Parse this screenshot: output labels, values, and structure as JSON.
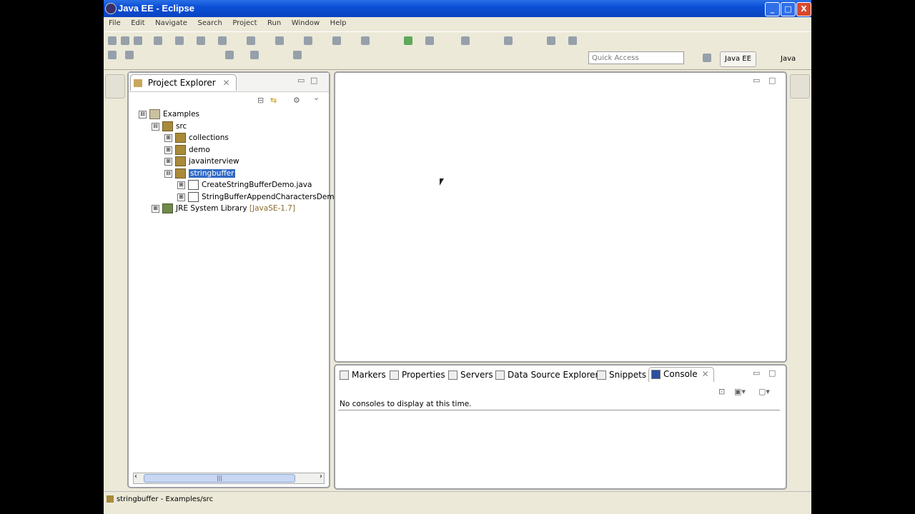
{
  "window": {
    "title": "Java EE - Eclipse",
    "minimize": "_",
    "maximize": "□",
    "close": "X"
  },
  "menu": [
    "File",
    "Edit",
    "Navigate",
    "Search",
    "Project",
    "Run",
    "Window",
    "Help"
  ],
  "toolbar": {
    "quick_access_placeholder": "Quick Access",
    "perspectives": [
      "Java EE",
      "Java"
    ]
  },
  "project_explorer": {
    "tab_label": "Project Explorer",
    "tree": [
      {
        "label": "Examples",
        "type": "project",
        "expander": "⊟"
      },
      {
        "label": "src",
        "type": "folder",
        "expander": "⊟"
      },
      {
        "label": "collections",
        "type": "package",
        "expander": "⊞"
      },
      {
        "label": "demo",
        "type": "package",
        "expander": "⊞"
      },
      {
        "label": "javainterview",
        "type": "package",
        "expander": "⊞"
      },
      {
        "label": "stringbuffer",
        "type": "package",
        "expander": "⊟",
        "selected": true
      },
      {
        "label": "CreateStringBufferDemo.java",
        "type": "file",
        "expander": "⊞"
      },
      {
        "label": "StringBufferAppendCharactersDemo",
        "type": "file",
        "expander": "⊞"
      },
      {
        "label": "JRE System Library",
        "type": "library",
        "expander": "⊞",
        "version": "[JavaSE-1.7]"
      }
    ],
    "scroll_thumb": "|||"
  },
  "bottom_panel": {
    "tabs": [
      "Markers",
      "Properties",
      "Servers",
      "Data Source Explorer",
      "Snippets",
      "Console"
    ],
    "active_tab": "Console",
    "message": "No consoles to display at this time."
  },
  "status_bar": {
    "text": "stringbuffer - Examples/src"
  },
  "colors": {
    "title_bar": "#0b4fd6",
    "selection": "#316ac5",
    "chrome": "#ece9d8"
  }
}
